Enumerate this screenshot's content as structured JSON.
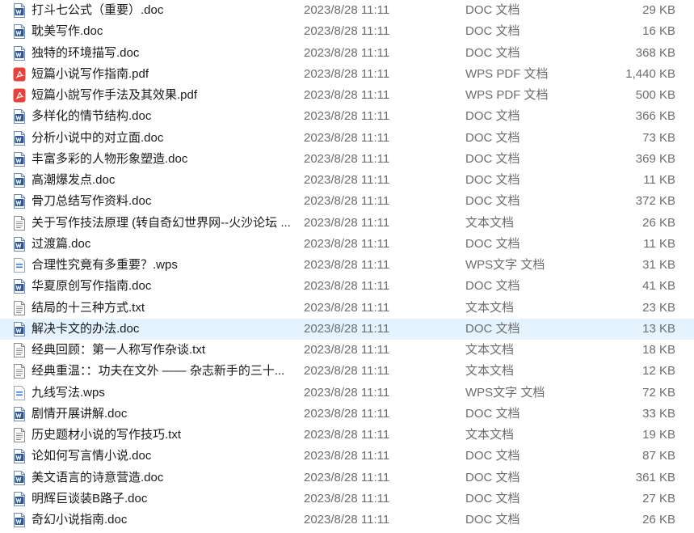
{
  "files": [
    {
      "name": "打斗七公式（重要）.doc",
      "modified": "2023/8/28 11:11",
      "type": "DOC 文档",
      "size": "29 KB",
      "icon": "word-doc-icon"
    },
    {
      "name": "耽美写作.doc",
      "modified": "2023/8/28 11:11",
      "type": "DOC 文档",
      "size": "16 KB",
      "icon": "word-doc-icon"
    },
    {
      "name": "独特的环境描写.doc",
      "modified": "2023/8/28 11:11",
      "type": "DOC 文档",
      "size": "368 KB",
      "icon": "word-doc-icon"
    },
    {
      "name": "短篇小说写作指南.pdf",
      "modified": "2023/8/28 11:11",
      "type": "WPS PDF 文档",
      "size": "1,440 KB",
      "icon": "pdf-icon"
    },
    {
      "name": "短篇小說写作手法及其效果.pdf",
      "modified": "2023/8/28 11:11",
      "type": "WPS PDF 文档",
      "size": "500 KB",
      "icon": "pdf-icon"
    },
    {
      "name": "多样化的情节结构.doc",
      "modified": "2023/8/28 11:11",
      "type": "DOC 文档",
      "size": "366 KB",
      "icon": "word-doc-icon"
    },
    {
      "name": "分析小说中的对立面.doc",
      "modified": "2023/8/28 11:11",
      "type": "DOC 文档",
      "size": "73 KB",
      "icon": "word-doc-icon"
    },
    {
      "name": "丰富多彩的人物形象塑造.doc",
      "modified": "2023/8/28 11:11",
      "type": "DOC 文档",
      "size": "369 KB",
      "icon": "word-doc-icon"
    },
    {
      "name": "高潮爆发点.doc",
      "modified": "2023/8/28 11:11",
      "type": "DOC 文档",
      "size": "11 KB",
      "icon": "word-doc-icon"
    },
    {
      "name": "骨刀总结写作资料.doc",
      "modified": "2023/8/28 11:11",
      "type": "DOC 文档",
      "size": "372 KB",
      "icon": "word-doc-icon"
    },
    {
      "name": "关于写作技法原理 (转自奇幻世界网--火沙论坛 ...",
      "modified": "2023/8/28 11:11",
      "type": "文本文档",
      "size": "26 KB",
      "icon": "text-file-icon"
    },
    {
      "name": "过渡篇.doc",
      "modified": "2023/8/28 11:11",
      "type": "DOC 文档",
      "size": "11 KB",
      "icon": "word-doc-icon"
    },
    {
      "name": "合理性究竟有多重要？.wps",
      "modified": "2023/8/28 11:11",
      "type": "WPS文字 文档",
      "size": "31 KB",
      "icon": "wps-doc-icon"
    },
    {
      "name": "华夏原创写作指南.doc",
      "modified": "2023/8/28 11:11",
      "type": "DOC 文档",
      "size": "41 KB",
      "icon": "word-doc-icon"
    },
    {
      "name": "结局的十三种方式.txt",
      "modified": "2023/8/28 11:11",
      "type": "文本文档",
      "size": "23 KB",
      "icon": "text-file-icon"
    },
    {
      "name": "解决卡文的办法.doc",
      "modified": "2023/8/28 11:11",
      "type": "DOC 文档",
      "size": "13 KB",
      "icon": "word-doc-icon",
      "selected": true
    },
    {
      "name": "经典回顾：第一人称写作杂谈.txt",
      "modified": "2023/8/28 11:11",
      "type": "文本文档",
      "size": "18 KB",
      "icon": "text-file-icon"
    },
    {
      "name": "经典重温：：功夫在文外 —— 杂志新手的三十...",
      "modified": "2023/8/28 11:11",
      "type": "文本文档",
      "size": "12 KB",
      "icon": "text-file-icon"
    },
    {
      "name": "九线写法.wps",
      "modified": "2023/8/28 11:11",
      "type": "WPS文字 文档",
      "size": "72 KB",
      "icon": "wps-doc-icon"
    },
    {
      "name": "剧情开展讲解.doc",
      "modified": "2023/8/28 11:11",
      "type": "DOC 文档",
      "size": "33 KB",
      "icon": "word-doc-icon"
    },
    {
      "name": "历史题材小说的写作技巧.txt",
      "modified": "2023/8/28 11:11",
      "type": "文本文档",
      "size": "19 KB",
      "icon": "text-file-icon"
    },
    {
      "name": "论如何写言情小说.doc",
      "modified": "2023/8/28 11:11",
      "type": "DOC 文档",
      "size": "87 KB",
      "icon": "word-doc-icon"
    },
    {
      "name": "美文语言的诗意营造.doc",
      "modified": "2023/8/28 11:11",
      "type": "DOC 文档",
      "size": "361 KB",
      "icon": "word-doc-icon"
    },
    {
      "name": "明辉巨谈装B路子.doc",
      "modified": "2023/8/28 11:11",
      "type": "DOC 文档",
      "size": "27 KB",
      "icon": "word-doc-icon"
    },
    {
      "name": "奇幻小说指南.doc",
      "modified": "2023/8/28 11:11",
      "type": "DOC 文档",
      "size": "26 KB",
      "icon": "word-doc-icon"
    }
  ],
  "colors": {
    "selection": "#e5f3ff",
    "word_blue": "#2b579a",
    "pdf_red": "#e8403a",
    "wps_blue": "#3b7de0"
  }
}
